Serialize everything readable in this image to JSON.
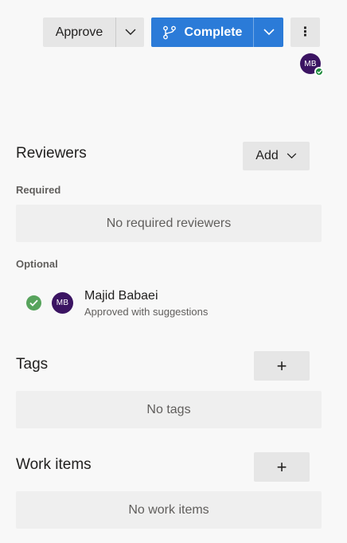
{
  "toolbar": {
    "approve_label": "Approve",
    "complete_label": "Complete",
    "more_label": "⋮",
    "primary_color": "#2b7bd8"
  },
  "current_user": {
    "initials": "MB",
    "status": "approved"
  },
  "reviewers": {
    "title": "Reviewers",
    "add_label": "Add",
    "required_label": "Required",
    "required_empty": "No required reviewers",
    "optional_label": "Optional",
    "optional": [
      {
        "initials": "MB",
        "name": "Majid Babaei",
        "status": "Approved with suggestions",
        "status_color": "#57a35c"
      }
    ]
  },
  "tags": {
    "title": "Tags",
    "add_label": "+",
    "empty": "No tags"
  },
  "work_items": {
    "title": "Work items",
    "add_label": "+",
    "empty": "No work items"
  },
  "icons": [
    "branch-icon",
    "chevron-down-icon",
    "more-icon",
    "check-icon",
    "plus-icon"
  ]
}
